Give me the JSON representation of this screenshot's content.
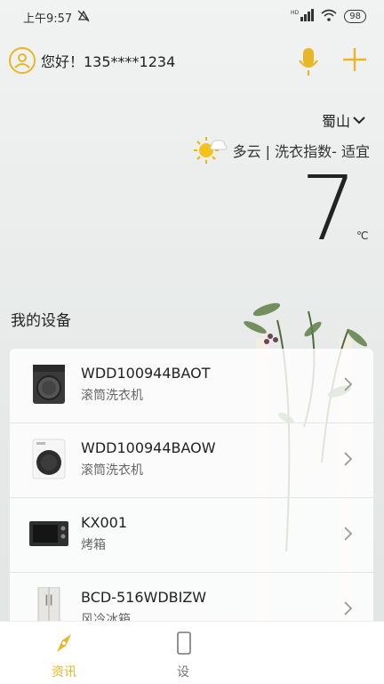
{
  "status": {
    "time": "上午9:57",
    "battery": "98",
    "signal": "HD"
  },
  "header": {
    "greeting": "您好！135****1234"
  },
  "weather": {
    "location": "蜀山",
    "description": "多云 | 洗衣指数- 适宜",
    "temperature": "7",
    "unit": "℃"
  },
  "devices_section": {
    "title": "我的设备"
  },
  "devices": [
    {
      "name": "WDD100944BAOT",
      "type": "滚筒洗衣机",
      "icon": "washer-dark-icon"
    },
    {
      "name": "WDD100944BAOW",
      "type": "滚筒洗衣机",
      "icon": "washer-white-icon"
    },
    {
      "name": "KX001",
      "type": "烤箱",
      "icon": "oven-icon"
    },
    {
      "name": "BCD-516WDBIZW",
      "type": "风冷冰箱",
      "icon": "fridge-icon"
    }
  ],
  "nav": {
    "items": [
      {
        "label": "资讯",
        "active": true
      },
      {
        "label": "设"
      }
    ]
  },
  "colors": {
    "accent": "#e9b626",
    "text": "#222222"
  }
}
